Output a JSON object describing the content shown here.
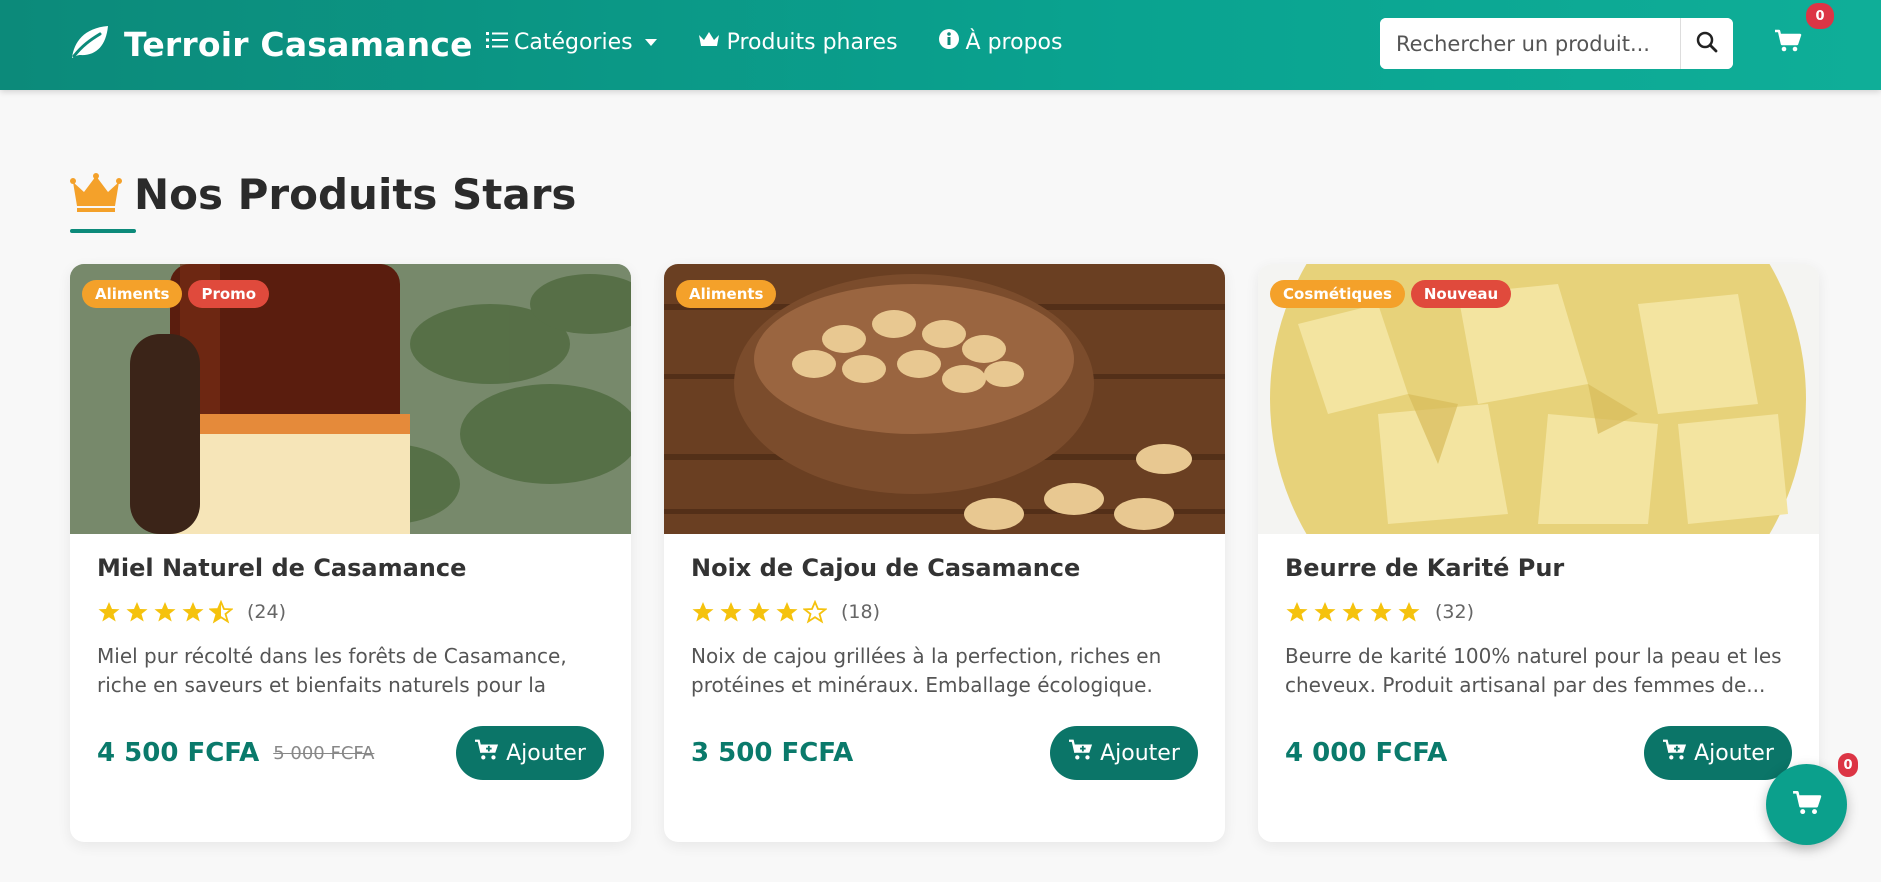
{
  "brand": {
    "title": "Terroir Casamance",
    "icon": "leaf-icon"
  },
  "nav": {
    "categories": "Catégories",
    "featured": "Produits phares",
    "about": "À propos"
  },
  "search": {
    "placeholder": "Rechercher un produit..."
  },
  "cart": {
    "count": "0",
    "fab_count": "0"
  },
  "section": {
    "title": "Nos Produits Stars",
    "icon": "crown-icon"
  },
  "colors": {
    "primary": "#0c8a7a",
    "accent": "#f4a12a",
    "danger": "#e04a3c",
    "star": "#f5c20d"
  },
  "products": [
    {
      "title": "Miel Naturel de Casamance",
      "tags": [
        "Aliments",
        "Promo"
      ],
      "rating": 4.5,
      "reviews": "(24)",
      "description": "Miel pur récolté dans les forêts de Casamance, riche en saveurs et bienfaits naturels pour la santé.",
      "price": "4 500 FCFA",
      "old_price": "5 000 FCFA",
      "button": "Ajouter"
    },
    {
      "title": "Noix de Cajou de Casamance",
      "tags": [
        "Aliments"
      ],
      "rating": 4,
      "reviews": "(18)",
      "description": "Noix de cajou grillées à la perfection, riches en protéines et minéraux. Emballage écologique.",
      "price": "3 500 FCFA",
      "old_price": "",
      "button": "Ajouter"
    },
    {
      "title": "Beurre de Karité Pur",
      "tags": [
        "Cosmétiques",
        "Nouveau"
      ],
      "rating": 5,
      "reviews": "(32)",
      "description": "Beurre de karité 100% naturel pour la peau et les cheveux. Produit artisanal par des femmes de...",
      "price": "4 000 FCFA",
      "old_price": "",
      "button": "Ajouter"
    }
  ]
}
